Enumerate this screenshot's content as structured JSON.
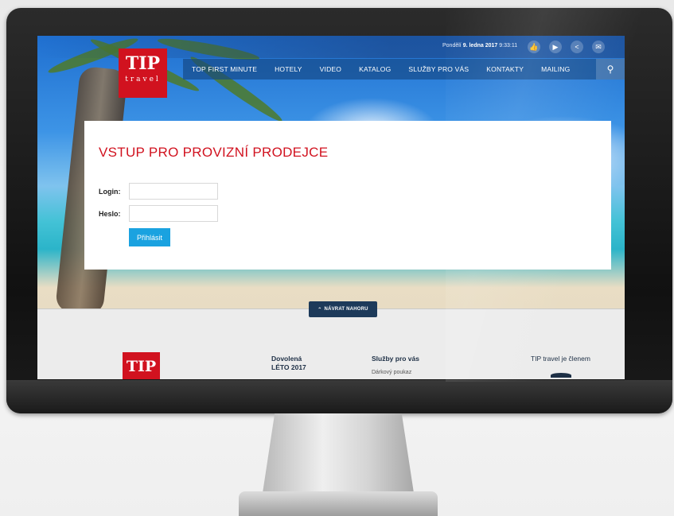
{
  "header": {
    "date_prefix": "Pondělí",
    "date_bold": "9. ledna 2017",
    "time": "9:33:11",
    "logo_big": "TIP",
    "logo_small": "travel",
    "nav": [
      {
        "label": "TOP FIRST MINUTE"
      },
      {
        "label": "HOTELY"
      },
      {
        "label": "VIDEO"
      },
      {
        "label": "KATALOG"
      },
      {
        "label": "SLUŽBY PRO VÁS"
      },
      {
        "label": "KONTAKTY"
      },
      {
        "label": "MAILING"
      }
    ],
    "social_icons": [
      "thumbs-up-icon",
      "play-icon",
      "share-icon",
      "mail-icon"
    ]
  },
  "login": {
    "title": "VSTUP PRO PROVIZNÍ PRODEJCE",
    "login_label": "Login:",
    "password_label": "Heslo:",
    "login_value": "",
    "password_value": "",
    "submit_label": "Přihlásit"
  },
  "back_to_top": {
    "label": "NÁVRAT NAHORU"
  },
  "footer": {
    "logo": "TIP",
    "col1_title_line1": "Dovolená",
    "col1_title_line2": "LÉTO 2017",
    "col2_title": "Služby pro vás",
    "col2_link": "Dárkový poukaz",
    "member_text": "TIP travel je členem"
  },
  "colors": {
    "brand_red": "#d1121f",
    "button_blue": "#1aa2e0",
    "nav_dark": "#1d3a5a"
  }
}
